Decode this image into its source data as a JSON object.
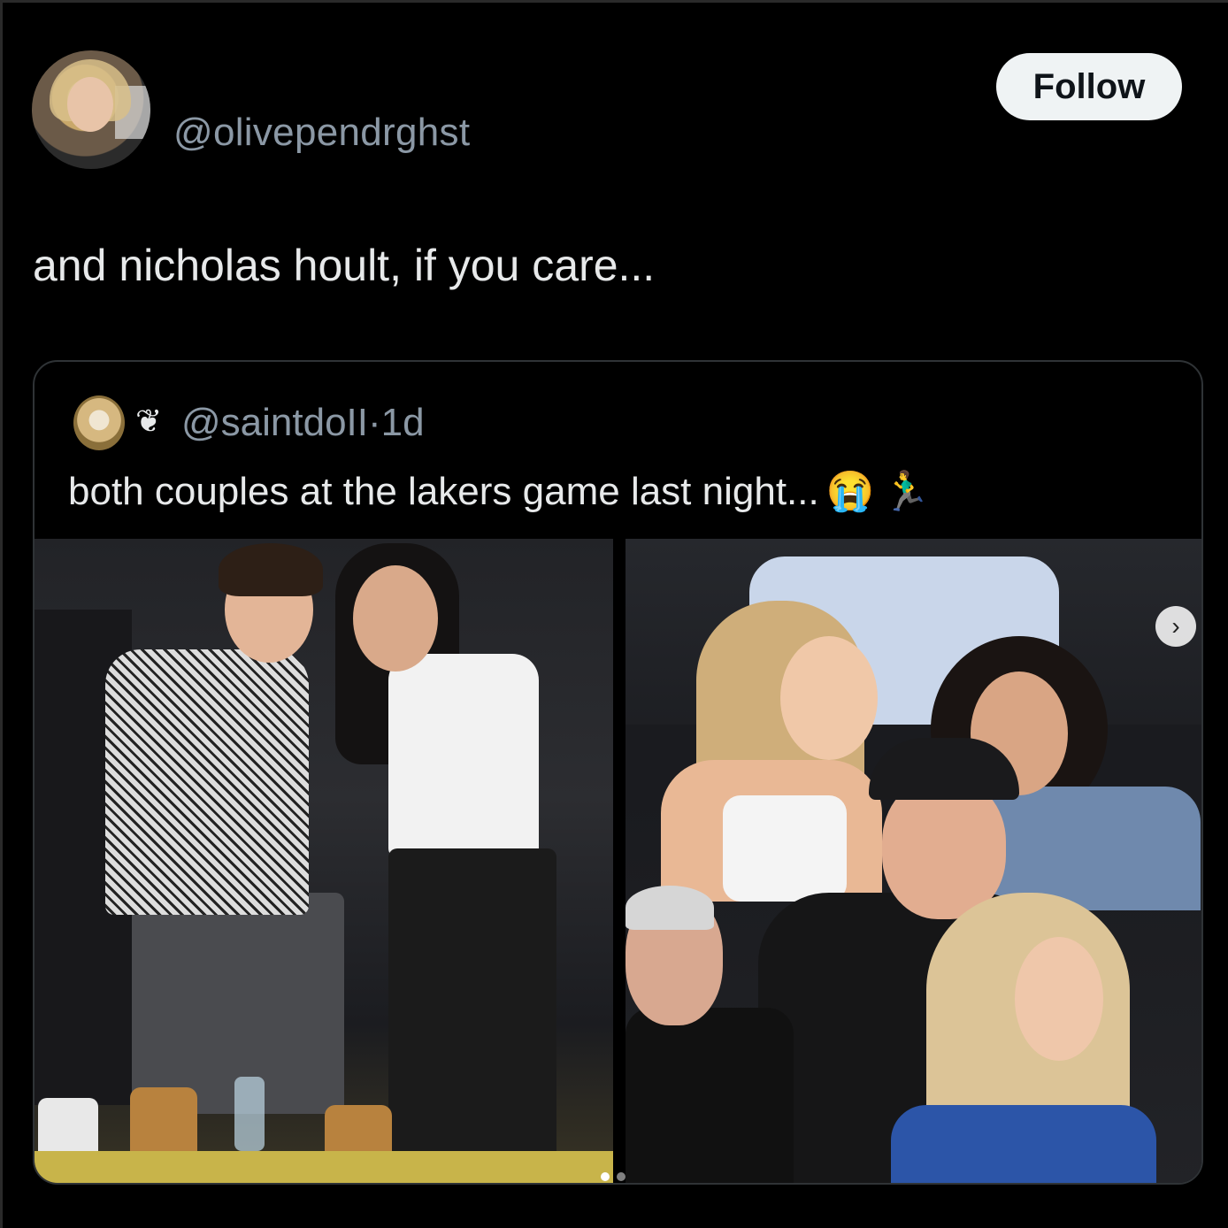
{
  "post": {
    "handle": "@olivependrghst",
    "follow_label": "Follow",
    "text": "and nicholas hoult, if you care..."
  },
  "quoted": {
    "heart_icon": "❦",
    "handle": "@saintdoII",
    "separator": "·",
    "time": "1d",
    "text": "both couples at the lakers game last night...",
    "emoji_1": "😭",
    "emoji_2": "🏃‍♂️"
  },
  "media": {
    "next_icon": "›",
    "carousel_count": 2,
    "carousel_active": 1
  },
  "colors": {
    "background": "#000000",
    "text_primary": "#e7e9ea",
    "text_secondary": "#8b98a5",
    "follow_bg": "#eff3f4",
    "card_border": "#2f3336"
  }
}
